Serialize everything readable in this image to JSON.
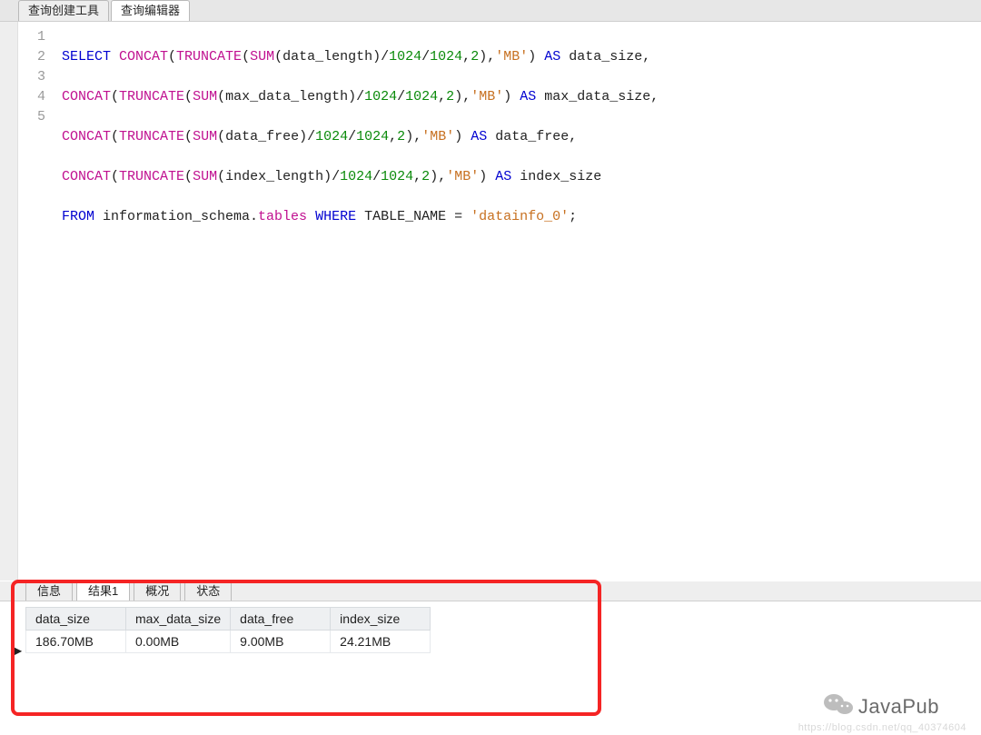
{
  "topTabs": {
    "builder": "查询创建工具",
    "editor": "查询编辑器"
  },
  "lines": [
    "1",
    "2",
    "3",
    "4",
    "5"
  ],
  "sql": {
    "l1": {
      "a": "SELECT ",
      "b": "CONCAT",
      "c": "(",
      "d": "TRUNCATE",
      "e": "(",
      "f": "SUM",
      "g": "(data_length)/",
      "h": "1024",
      "i": "/",
      "j": "1024",
      "k": ",",
      "l": "2",
      "m": "),",
      "n": "'MB'",
      "o": ") ",
      "p": "AS ",
      "q": "data_size,"
    },
    "l2": {
      "a": "CONCAT",
      "b": "(",
      "c": "TRUNCATE",
      "d": "(",
      "e": "SUM",
      "f": "(max_data_length)/",
      "g": "1024",
      "h": "/",
      "i": "1024",
      "j": ",",
      "k": "2",
      "l": "),",
      "m": "'MB'",
      "n": ") ",
      "o": "AS ",
      "p": "max_data_size,"
    },
    "l3": {
      "a": "CONCAT",
      "b": "(",
      "c": "TRUNCATE",
      "d": "(",
      "e": "SUM",
      "f": "(data_free)/",
      "g": "1024",
      "h": "/",
      "i": "1024",
      "j": ",",
      "k": "2",
      "l": "),",
      "m": "'MB'",
      "n": ") ",
      "o": "AS ",
      "p": "data_free,"
    },
    "l4": {
      "a": "CONCAT",
      "b": "(",
      "c": "TRUNCATE",
      "d": "(",
      "e": "SUM",
      "f": "(index_length)/",
      "g": "1024",
      "h": "/",
      "i": "1024",
      "j": ",",
      "k": "2",
      "l": "),",
      "m": "'MB'",
      "n": ") ",
      "o": "AS ",
      "p": "index_size"
    },
    "l5": {
      "a": "FROM ",
      "b": "information_schema.",
      "c": "tables ",
      "d": "WHERE ",
      "e": "TABLE_NAME = ",
      "f": "'datainfo_0'",
      "g": ";"
    }
  },
  "resultTabs": {
    "info": "信息",
    "result1": "结果1",
    "summary": "概况",
    "status": "状态"
  },
  "result": {
    "headers": {
      "c1": "data_size",
      "c2": "max_data_size",
      "c3": "data_free",
      "c4": "index_size"
    },
    "row": {
      "c1": "186.70MB",
      "c2": "0.00MB",
      "c3": "9.00MB",
      "c4": "24.21MB"
    }
  },
  "rowMarker": "▶",
  "watermark": {
    "brand": "JavaPub",
    "url": "https://blog.csdn.net/qq_40374604"
  }
}
